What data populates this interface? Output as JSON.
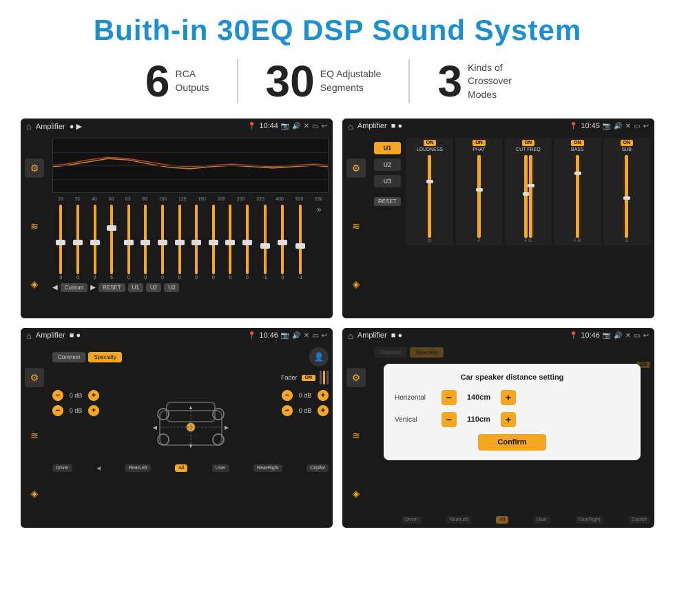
{
  "header": {
    "title": "Buith-in 30EQ DSP Sound System"
  },
  "stats": [
    {
      "number": "6",
      "label": "RCA\nOutputs"
    },
    {
      "number": "30",
      "label": "EQ Adjustable\nSegments"
    },
    {
      "number": "3",
      "label": "Kinds of\nCrossover Modes"
    }
  ],
  "screens": [
    {
      "id": "eq-screen",
      "statusBar": {
        "title": "Amplifier",
        "time": "10:44"
      }
    },
    {
      "id": "crossover-screen",
      "statusBar": {
        "title": "Amplifier",
        "time": "10:45"
      }
    },
    {
      "id": "fader-screen",
      "statusBar": {
        "title": "Amplifier",
        "time": "10:46"
      }
    },
    {
      "id": "distance-screen",
      "statusBar": {
        "title": "Amplifier",
        "time": "10:46"
      }
    }
  ],
  "eq": {
    "frequencies": [
      "25",
      "32",
      "40",
      "50",
      "63",
      "80",
      "100",
      "125",
      "160",
      "200",
      "250",
      "320",
      "400",
      "500",
      "630"
    ],
    "values": [
      "0",
      "0",
      "0",
      "5",
      "0",
      "0",
      "0",
      "0",
      "0",
      "0",
      "0",
      "0",
      "-1",
      "0",
      "-1"
    ],
    "preset": "Custom",
    "buttons": [
      "RESET",
      "U1",
      "U2",
      "U3"
    ]
  },
  "crossover": {
    "units": [
      "U1",
      "U2",
      "U3"
    ],
    "channels": [
      {
        "name": "LOUDNESS",
        "on": true
      },
      {
        "name": "PHAT",
        "on": true
      },
      {
        "name": "CUT FREQ",
        "on": true
      },
      {
        "name": "BASS",
        "on": true
      },
      {
        "name": "SUB",
        "on": true
      }
    ],
    "resetLabel": "RESET"
  },
  "fader": {
    "tabs": [
      "Common",
      "Specialty"
    ],
    "activeTab": "Specialty",
    "faderLabel": "Fader",
    "onLabel": "ON",
    "positions": {
      "driver": "Driver",
      "copilot": "Copilot",
      "rearLeft": "RearLeft",
      "all": "All",
      "user": "User",
      "rearRight": "RearRight"
    },
    "dbValues": [
      "0 dB",
      "0 dB",
      "0 dB",
      "0 dB"
    ]
  },
  "distance": {
    "dialogTitle": "Car speaker distance setting",
    "horizontal": {
      "label": "Horizontal",
      "value": "140cm"
    },
    "vertical": {
      "label": "Vertical",
      "value": "110cm"
    },
    "confirmLabel": "Confirm",
    "tabs": [
      "Common",
      "Specialty"
    ],
    "positions": {
      "driver": "Driver",
      "copilot": "Copilot",
      "rearLeft": "RearLeft",
      "rearRight": "RearRight"
    }
  }
}
